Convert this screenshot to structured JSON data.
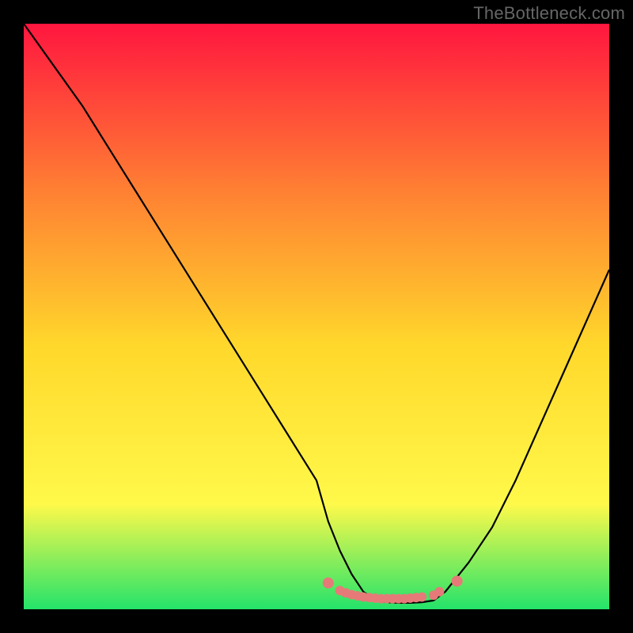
{
  "watermark": "TheBottleneck.com",
  "chart_data": {
    "type": "line",
    "title": "",
    "xlabel": "",
    "ylabel": "",
    "xlim": [
      0,
      100
    ],
    "ylim": [
      0,
      100
    ],
    "grid": false,
    "legend": false,
    "background_gradient": {
      "top": "#ff163f",
      "mid_upper": "#ff7e33",
      "mid": "#ffd82b",
      "mid_lower": "#fff94a",
      "bottom": "#24e36a"
    },
    "series": [
      {
        "name": "bottleneck-curve",
        "color": "#000000",
        "x": [
          0,
          5,
          10,
          15,
          20,
          25,
          30,
          35,
          40,
          45,
          50,
          52,
          54,
          56,
          58,
          60,
          62,
          64,
          66,
          68,
          70,
          72,
          76,
          80,
          84,
          88,
          92,
          96,
          100
        ],
        "y": [
          100,
          93,
          86,
          78,
          70,
          62,
          54,
          46,
          38,
          30,
          22,
          15,
          10,
          6,
          3,
          1.5,
          1.2,
          1.1,
          1.1,
          1.2,
          1.5,
          3,
          8,
          14,
          22,
          31,
          40,
          49,
          58
        ]
      },
      {
        "name": "optimal-range-marker",
        "color": "#e67a78",
        "type": "dots",
        "x": [
          52,
          54,
          55,
          56,
          57,
          58,
          59,
          60,
          61,
          62,
          63,
          64,
          65,
          66,
          67,
          68,
          70,
          71,
          74
        ],
        "y": [
          4.5,
          3.2,
          2.8,
          2.5,
          2.3,
          2.1,
          2.0,
          1.9,
          1.8,
          1.8,
          1.8,
          1.8,
          1.8,
          1.9,
          2.0,
          2.1,
          2.4,
          3.0,
          4.8
        ]
      }
    ]
  }
}
